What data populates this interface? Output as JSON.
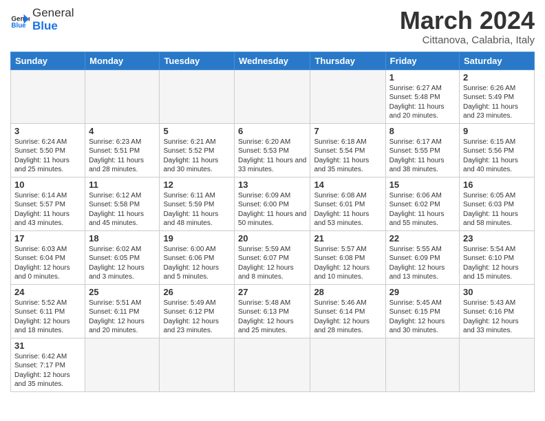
{
  "logo": {
    "word1": "General",
    "word2": "Blue"
  },
  "title": "March 2024",
  "location": "Cittanova, Calabria, Italy",
  "headers": [
    "Sunday",
    "Monday",
    "Tuesday",
    "Wednesday",
    "Thursday",
    "Friday",
    "Saturday"
  ],
  "weeks": [
    [
      {
        "day": "",
        "info": ""
      },
      {
        "day": "",
        "info": ""
      },
      {
        "day": "",
        "info": ""
      },
      {
        "day": "",
        "info": ""
      },
      {
        "day": "",
        "info": ""
      },
      {
        "day": "1",
        "info": "Sunrise: 6:27 AM\nSunset: 5:48 PM\nDaylight: 11 hours and 20 minutes."
      },
      {
        "day": "2",
        "info": "Sunrise: 6:26 AM\nSunset: 5:49 PM\nDaylight: 11 hours and 23 minutes."
      }
    ],
    [
      {
        "day": "3",
        "info": "Sunrise: 6:24 AM\nSunset: 5:50 PM\nDaylight: 11 hours and 25 minutes."
      },
      {
        "day": "4",
        "info": "Sunrise: 6:23 AM\nSunset: 5:51 PM\nDaylight: 11 hours and 28 minutes."
      },
      {
        "day": "5",
        "info": "Sunrise: 6:21 AM\nSunset: 5:52 PM\nDaylight: 11 hours and 30 minutes."
      },
      {
        "day": "6",
        "info": "Sunrise: 6:20 AM\nSunset: 5:53 PM\nDaylight: 11 hours and 33 minutes."
      },
      {
        "day": "7",
        "info": "Sunrise: 6:18 AM\nSunset: 5:54 PM\nDaylight: 11 hours and 35 minutes."
      },
      {
        "day": "8",
        "info": "Sunrise: 6:17 AM\nSunset: 5:55 PM\nDaylight: 11 hours and 38 minutes."
      },
      {
        "day": "9",
        "info": "Sunrise: 6:15 AM\nSunset: 5:56 PM\nDaylight: 11 hours and 40 minutes."
      }
    ],
    [
      {
        "day": "10",
        "info": "Sunrise: 6:14 AM\nSunset: 5:57 PM\nDaylight: 11 hours and 43 minutes."
      },
      {
        "day": "11",
        "info": "Sunrise: 6:12 AM\nSunset: 5:58 PM\nDaylight: 11 hours and 45 minutes."
      },
      {
        "day": "12",
        "info": "Sunrise: 6:11 AM\nSunset: 5:59 PM\nDaylight: 11 hours and 48 minutes."
      },
      {
        "day": "13",
        "info": "Sunrise: 6:09 AM\nSunset: 6:00 PM\nDaylight: 11 hours and 50 minutes."
      },
      {
        "day": "14",
        "info": "Sunrise: 6:08 AM\nSunset: 6:01 PM\nDaylight: 11 hours and 53 minutes."
      },
      {
        "day": "15",
        "info": "Sunrise: 6:06 AM\nSunset: 6:02 PM\nDaylight: 11 hours and 55 minutes."
      },
      {
        "day": "16",
        "info": "Sunrise: 6:05 AM\nSunset: 6:03 PM\nDaylight: 11 hours and 58 minutes."
      }
    ],
    [
      {
        "day": "17",
        "info": "Sunrise: 6:03 AM\nSunset: 6:04 PM\nDaylight: 12 hours and 0 minutes."
      },
      {
        "day": "18",
        "info": "Sunrise: 6:02 AM\nSunset: 6:05 PM\nDaylight: 12 hours and 3 minutes."
      },
      {
        "day": "19",
        "info": "Sunrise: 6:00 AM\nSunset: 6:06 PM\nDaylight: 12 hours and 5 minutes."
      },
      {
        "day": "20",
        "info": "Sunrise: 5:59 AM\nSunset: 6:07 PM\nDaylight: 12 hours and 8 minutes."
      },
      {
        "day": "21",
        "info": "Sunrise: 5:57 AM\nSunset: 6:08 PM\nDaylight: 12 hours and 10 minutes."
      },
      {
        "day": "22",
        "info": "Sunrise: 5:55 AM\nSunset: 6:09 PM\nDaylight: 12 hours and 13 minutes."
      },
      {
        "day": "23",
        "info": "Sunrise: 5:54 AM\nSunset: 6:10 PM\nDaylight: 12 hours and 15 minutes."
      }
    ],
    [
      {
        "day": "24",
        "info": "Sunrise: 5:52 AM\nSunset: 6:11 PM\nDaylight: 12 hours and 18 minutes."
      },
      {
        "day": "25",
        "info": "Sunrise: 5:51 AM\nSunset: 6:11 PM\nDaylight: 12 hours and 20 minutes."
      },
      {
        "day": "26",
        "info": "Sunrise: 5:49 AM\nSunset: 6:12 PM\nDaylight: 12 hours and 23 minutes."
      },
      {
        "day": "27",
        "info": "Sunrise: 5:48 AM\nSunset: 6:13 PM\nDaylight: 12 hours and 25 minutes."
      },
      {
        "day": "28",
        "info": "Sunrise: 5:46 AM\nSunset: 6:14 PM\nDaylight: 12 hours and 28 minutes."
      },
      {
        "day": "29",
        "info": "Sunrise: 5:45 AM\nSunset: 6:15 PM\nDaylight: 12 hours and 30 minutes."
      },
      {
        "day": "30",
        "info": "Sunrise: 5:43 AM\nSunset: 6:16 PM\nDaylight: 12 hours and 33 minutes."
      }
    ],
    [
      {
        "day": "31",
        "info": "Sunrise: 6:42 AM\nSunset: 7:17 PM\nDaylight: 12 hours and 35 minutes."
      },
      {
        "day": "",
        "info": ""
      },
      {
        "day": "",
        "info": ""
      },
      {
        "day": "",
        "info": ""
      },
      {
        "day": "",
        "info": ""
      },
      {
        "day": "",
        "info": ""
      },
      {
        "day": "",
        "info": ""
      }
    ]
  ]
}
